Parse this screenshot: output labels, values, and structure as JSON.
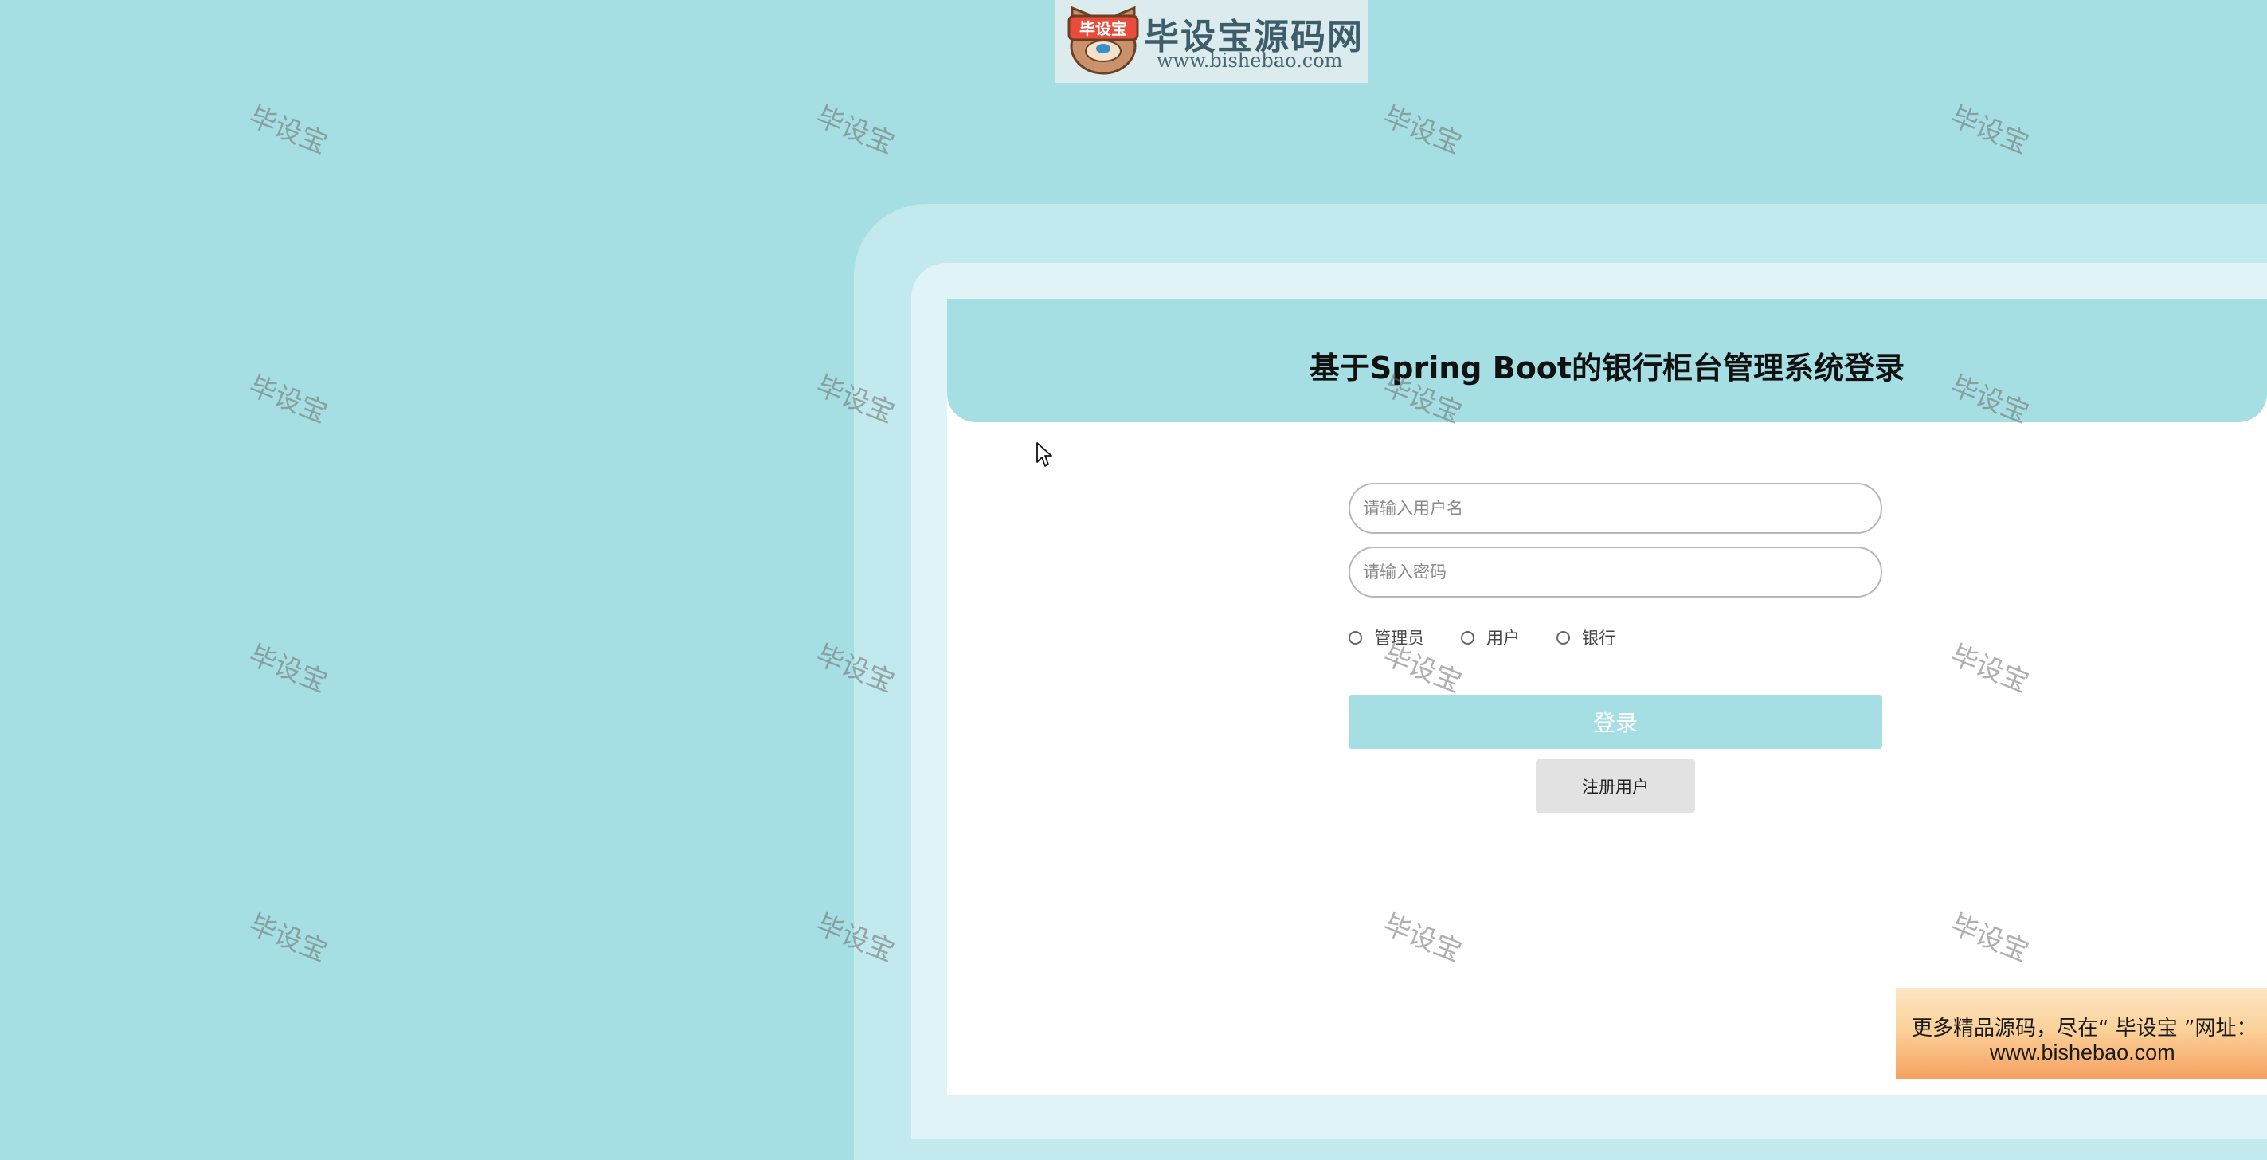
{
  "logo": {
    "badge_text": "毕设宝",
    "title": "毕设宝源码网",
    "url": "www.bishebao.com"
  },
  "watermark_text": "毕设宝",
  "login": {
    "title": "基于Spring Boot的银行柜台管理系统登录",
    "username_placeholder": "请输入用户名",
    "password_placeholder": "请输入密码",
    "roles": [
      "管理员",
      "用户",
      "银行"
    ],
    "login_label": "登录",
    "register_label": "注册用户"
  },
  "ad": {
    "line1": "更多精品源码，尽在“ 毕设宝 ”网址：",
    "line2": "www.bishebao.com"
  },
  "colors": {
    "background": "#a6dfe3",
    "frame_outer": "#c2e9ed",
    "frame_inner": "#e0f4f7",
    "accent": "#a6dfe3",
    "register_button": "#e2e2e2"
  }
}
